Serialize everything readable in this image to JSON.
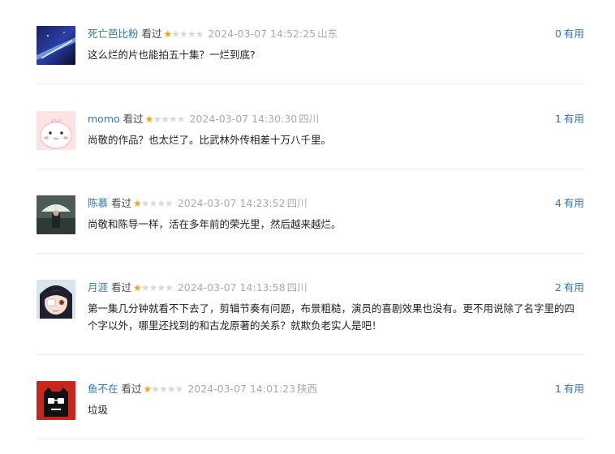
{
  "comments": [
    {
      "user": "死亡芭比粉",
      "status": "看过",
      "rating": 1,
      "max_rating": 5,
      "time": "2024-03-07 14:52:25",
      "location": "山东",
      "votes": "0",
      "votes_label": "有用",
      "text": "这么烂的片也能拍五十集？一烂到底?"
    },
    {
      "user": "momo",
      "status": "看过",
      "rating": 1,
      "max_rating": 5,
      "time": "2024-03-07 14:30:30",
      "location": "四川",
      "votes": "1",
      "votes_label": "有用",
      "text": "尚敬的作品？也太烂了。比武林外传相差十万八千里。"
    },
    {
      "user": "陈慕",
      "status": "看过",
      "rating": 1,
      "max_rating": 5,
      "time": "2024-03-07 14:23:52",
      "location": "四川",
      "votes": "4",
      "votes_label": "有用",
      "text": "尚敬和陈导一样，活在多年前的荣光里，然后越来越烂。"
    },
    {
      "user": "月涯",
      "status": "看过",
      "rating": 1,
      "max_rating": 5,
      "time": "2024-03-07 14:13:58",
      "location": "四川",
      "votes": "2",
      "votes_label": "有用",
      "text": "第一集几分钟就看不下去了，剪辑节奏有问题，布景粗糙，演员的喜剧效果也没有。更不用说除了名字里的四个字以外，哪里还找到的和古龙原著的关系？就欺负老实人是吧！"
    },
    {
      "user": "鱼不在",
      "status": "看过",
      "rating": 1,
      "max_rating": 5,
      "time": "2024-03-07 14:01:23",
      "location": "陕西",
      "votes": "1",
      "votes_label": "有用",
      "text": "垃圾"
    }
  ],
  "colors": {
    "link": "#3377aa",
    "star_on": "#f4a21a",
    "star_off": "#d8d8d8",
    "meta_gray": "#aaaaaa",
    "text": "#222222"
  }
}
